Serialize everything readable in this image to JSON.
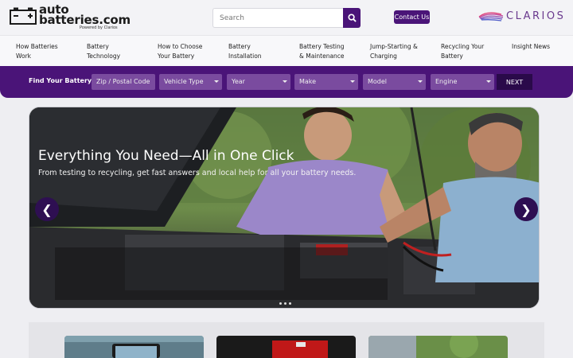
{
  "header": {
    "logo_line1": "auto",
    "logo_line2": "batteries.com",
    "logo_powered": "Powered by Clarios",
    "search_placeholder": "Search",
    "contact_label": "Contact Us",
    "partner_logo": "CLARIOS"
  },
  "nav": {
    "items": [
      {
        "label": "How Batteries\nWork"
      },
      {
        "label": "Battery\nTechnology"
      },
      {
        "label": "How to Choose\nYour Battery"
      },
      {
        "label": "Battery\nInstallation"
      },
      {
        "label": "Battery Testing\n& Maintenance"
      },
      {
        "label": "Jump-Starting &\nCharging"
      },
      {
        "label": "Recycling Your\nBattery"
      },
      {
        "label": "Insight News"
      }
    ]
  },
  "finder": {
    "label": "Find Your Battery",
    "zip_placeholder": "Zip / Postal Code",
    "vehicle_type": "Vehicle Type",
    "year": "Year",
    "make": "Make",
    "model": "Model",
    "engine": "Engine",
    "next_label": "NEXT"
  },
  "hero": {
    "title": "Everything You Need—All in One Click",
    "subtitle": "From testing to recycling, get fast answers and local help for all your battery needs.",
    "prev_icon": "❮",
    "next_icon": "❯"
  },
  "colors": {
    "brand_purple": "#4a1478",
    "finder_field": "#7a4b9f",
    "next_button": "#2a0a4a"
  }
}
